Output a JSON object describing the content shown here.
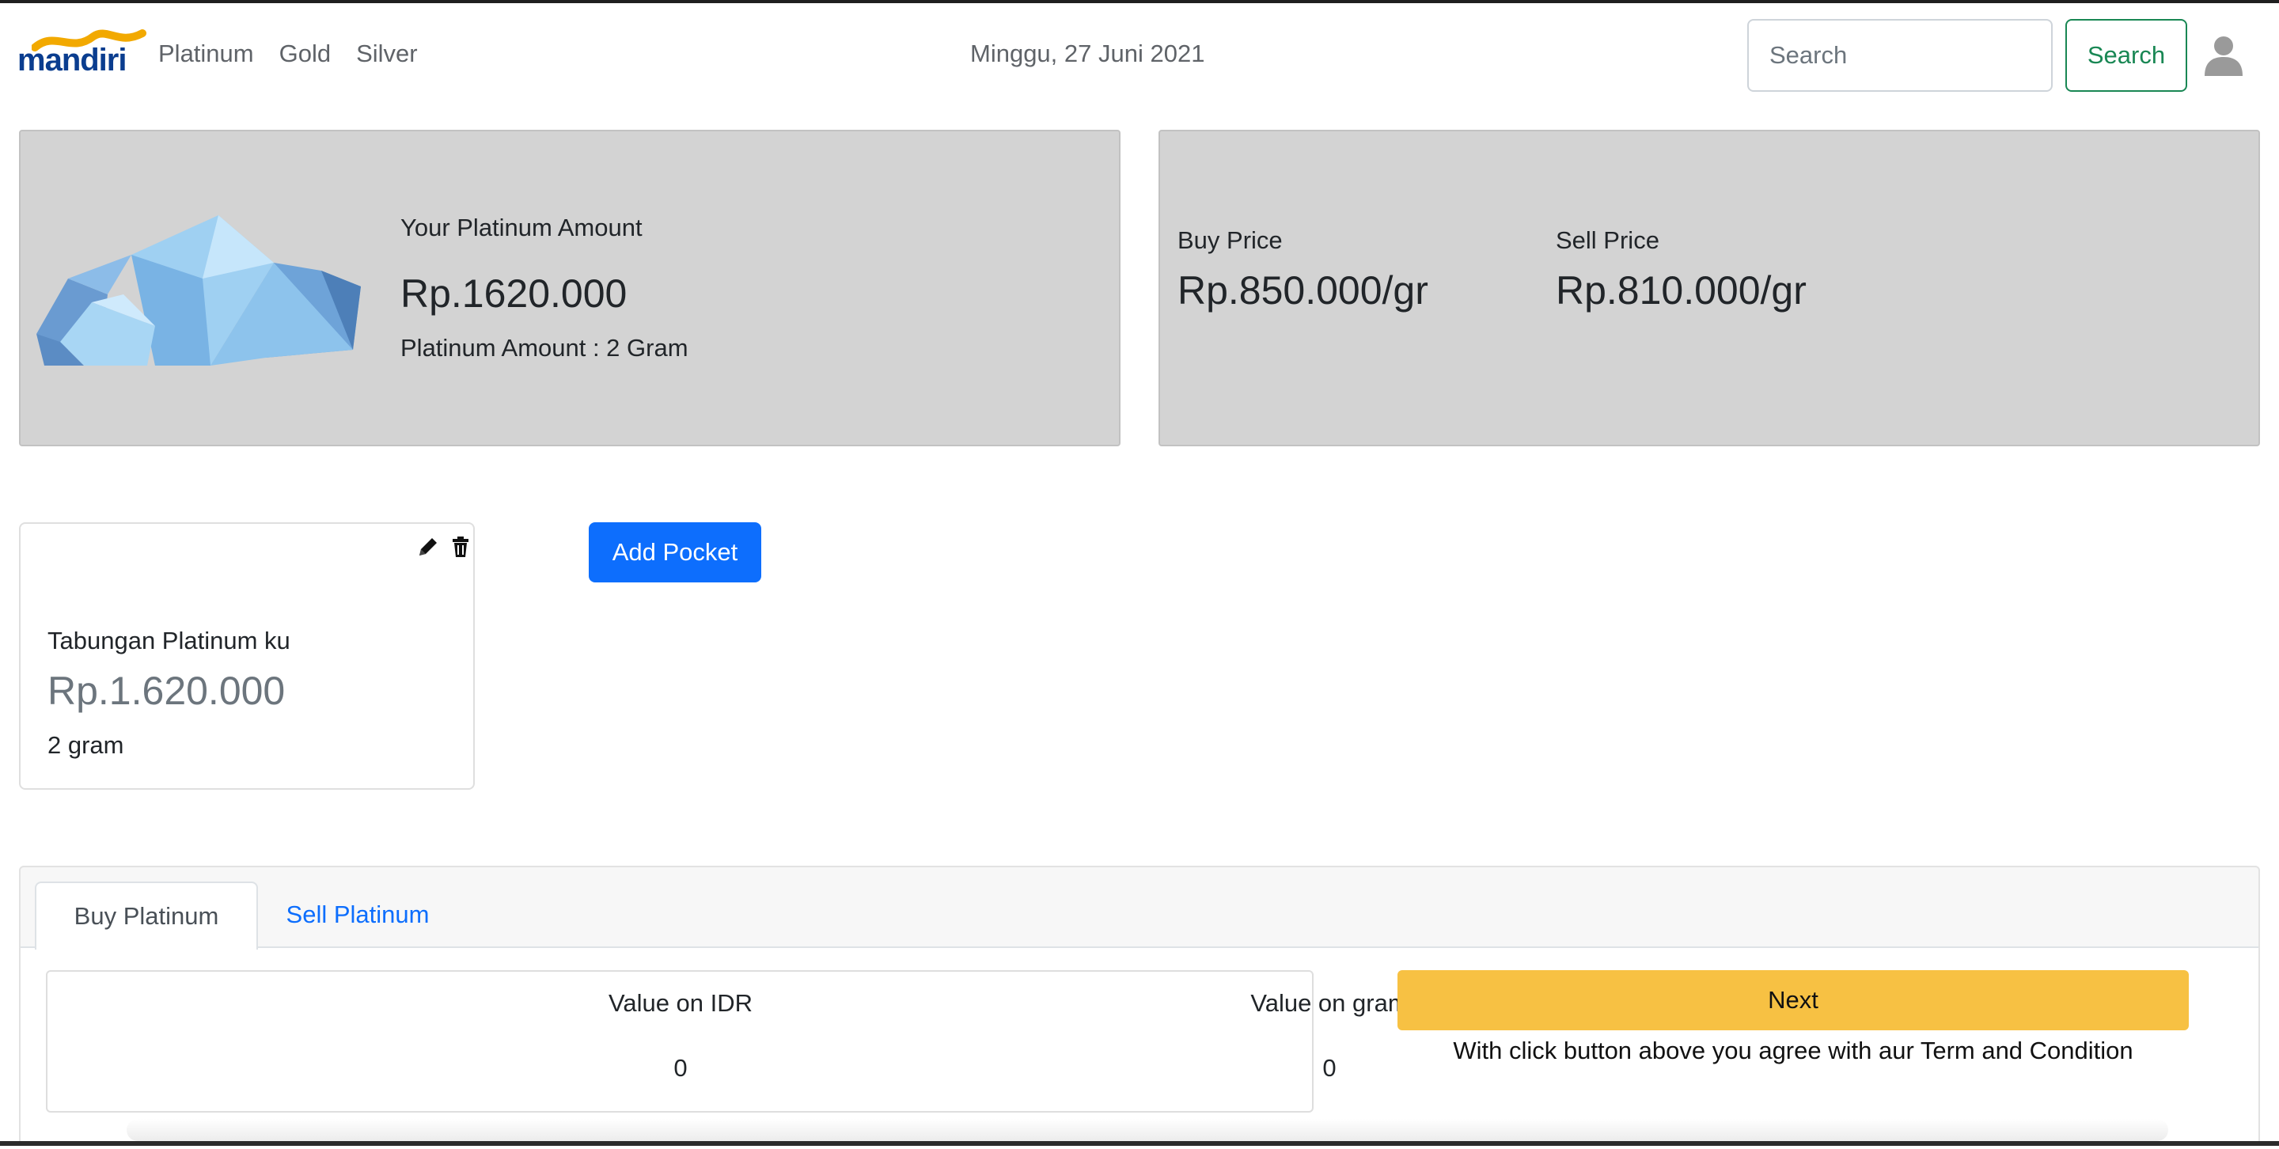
{
  "navbar": {
    "logo_text": "mandiri",
    "links": [
      "Platinum",
      "Gold",
      "Silver"
    ],
    "date": "Minggu, 27 Juni 2021",
    "search_placeholder": "Search",
    "search_button": "Search",
    "icons": {
      "user": "user-icon"
    }
  },
  "summary": {
    "title": "Your Platinum Amount",
    "amount": "Rp.1620.000",
    "gram_text": "Platinum Amount : 2 Gram",
    "image": "platinum-crystal"
  },
  "prices": {
    "buy_label": "Buy Price",
    "buy_value": "Rp.850.000/gr",
    "sell_label": "Sell Price",
    "sell_value": "Rp.810.000/gr"
  },
  "pocket": {
    "name": "Tabungan Platinum ku",
    "balance": "Rp.1.620.000",
    "gram": "2 gram",
    "icons": {
      "edit": "pencil-icon",
      "delete": "trash-icon"
    }
  },
  "add_pocket_label": "Add Pocket",
  "tabs": [
    {
      "label": "Buy Platinum",
      "active": true
    },
    {
      "label": "Sell Platinum",
      "active": false
    }
  ],
  "trade": {
    "idr_label": "Value on IDR",
    "idr_value": "0",
    "gram_label": "Value on gram",
    "gram_value": "0",
    "next_label": "Next",
    "terms": "With click button above you agree with aur Term and Condition"
  },
  "colors": {
    "primary": "#0d6efd",
    "success": "#198754",
    "warning": "#f7c143",
    "card_bg": "#d3d3d3",
    "brand_blue": "#0a3d8f",
    "brand_gold": "#f2a900"
  }
}
